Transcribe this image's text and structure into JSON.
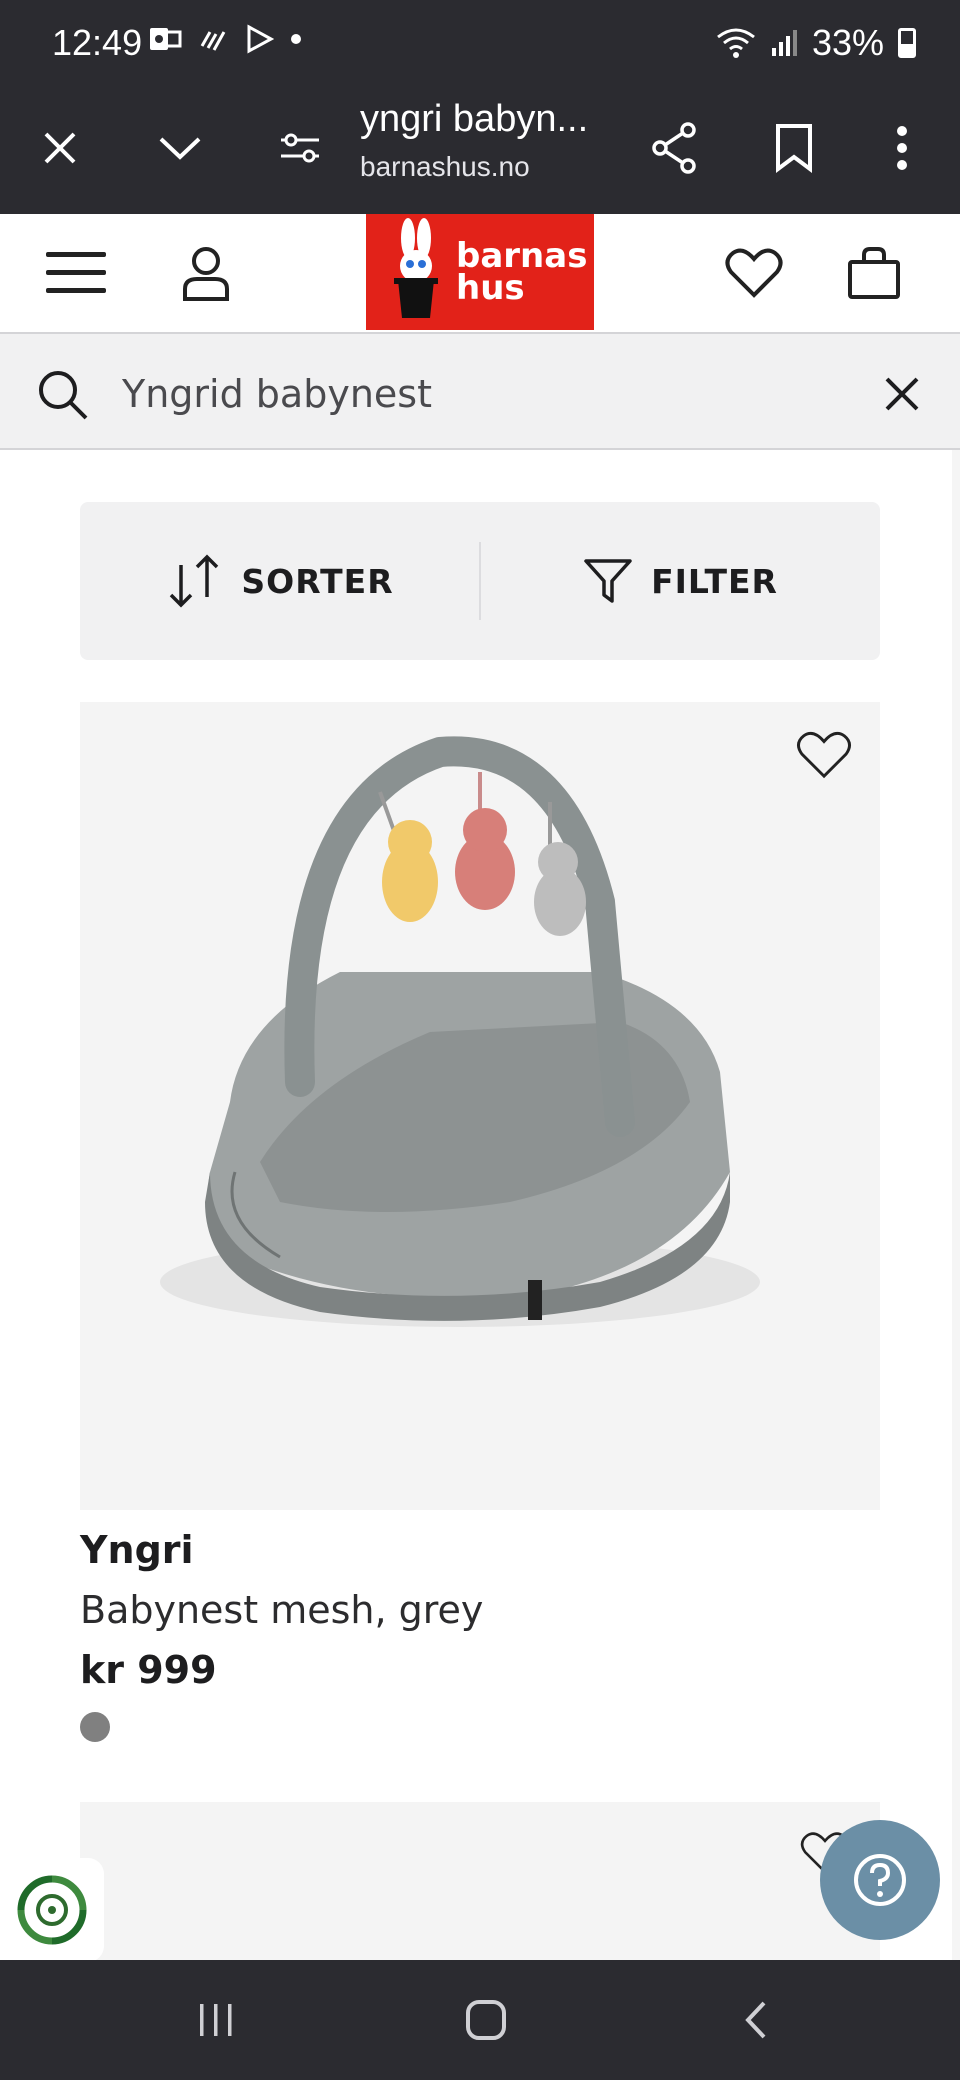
{
  "status_bar": {
    "time": "12:49",
    "battery": "33%"
  },
  "browser": {
    "page_title": "yngri babyn...",
    "domain": "barnashus.no"
  },
  "logo": {
    "line1": "barnas",
    "line2": "hus"
  },
  "search": {
    "value": "Yngrid babynest"
  },
  "toolbar": {
    "sort_label": "SORTER",
    "filter_label": "FILTER"
  },
  "product": {
    "brand": "Yngri",
    "name": "Babynest mesh, grey",
    "price": "kr 999",
    "swatch_color": "#808080"
  },
  "colors": {
    "brand_red": "#e22219",
    "chrome_dark": "#2b2b30",
    "help_button": "#6b8fa6"
  }
}
